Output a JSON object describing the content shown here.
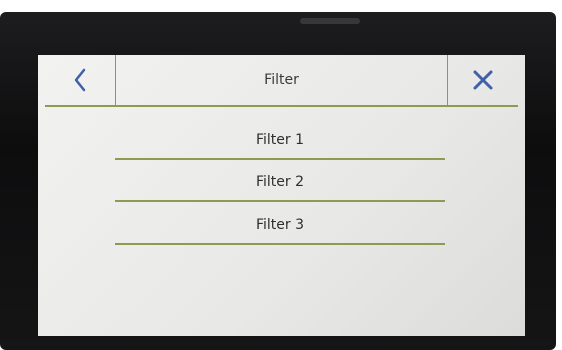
{
  "header": {
    "title": "Filter"
  },
  "menu": {
    "items": [
      {
        "label": "Filter 1"
      },
      {
        "label": "Filter 2"
      },
      {
        "label": "Filter 3"
      }
    ]
  },
  "colors": {
    "accent": "#8c9a52",
    "icon": "#3f5fa8",
    "bezel": "#141415",
    "screen": "#eaeae8"
  },
  "icons": {
    "back": "chevron-left-icon",
    "close": "close-icon"
  }
}
